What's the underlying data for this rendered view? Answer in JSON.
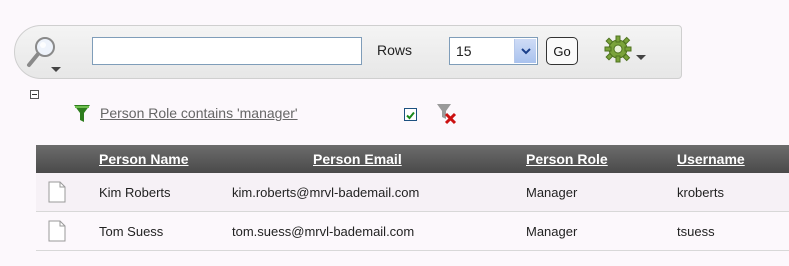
{
  "toolbar": {
    "search_value": "",
    "rows_label": "Rows",
    "rows_value": "15",
    "go_label": "Go"
  },
  "filter": {
    "text": "Person Role contains 'manager'",
    "enabled": true
  },
  "table": {
    "headers": [
      "Person Name",
      "Person Email",
      "Person Role",
      "Username"
    ],
    "rows": [
      [
        "Kim Roberts",
        "kim.roberts@mrvl-bademail.com",
        "Manager",
        "kroberts"
      ],
      [
        "Tom Suess",
        "tom.suess@mrvl-bademail.com",
        "Manager",
        "tsuess"
      ]
    ]
  },
  "colors": {
    "link": "#666666",
    "header_bg": "#555555",
    "filter_green": "#2e7d1e",
    "delete_red": "#cc1111"
  },
  "icons": {
    "search": "magnifier-icon",
    "actions": "gear-icon",
    "filter": "funnel-icon",
    "remove_filter": "funnel-delete-icon",
    "row_detail": "document-icon"
  }
}
